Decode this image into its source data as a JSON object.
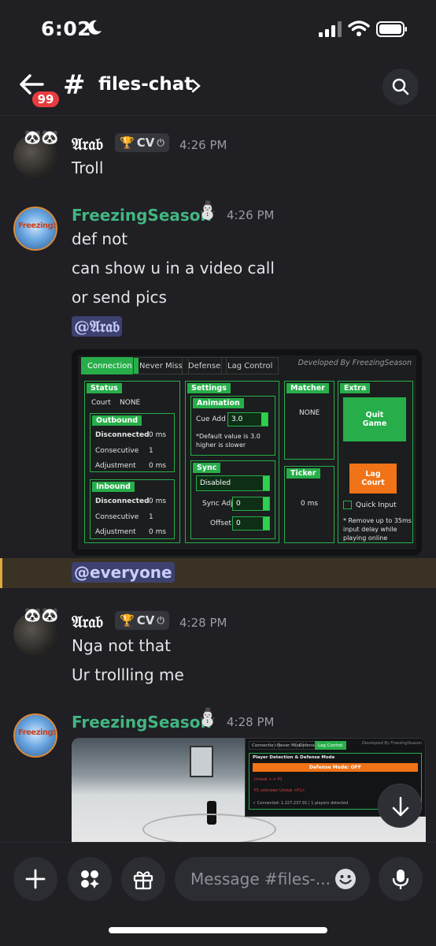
{
  "status_bar": {
    "time": "6:02"
  },
  "header": {
    "unread_badge": "99",
    "hash": "#",
    "channel_name": "files-chat"
  },
  "messages": [
    {
      "author": "𝔄𝔯𝔞𝔟",
      "tag": "CV",
      "time": "4:26 PM",
      "lines": [
        "Troll"
      ]
    },
    {
      "author": "FreezingSeason",
      "time": "4:26 PM",
      "avatar_text": "FreezingSeason",
      "lines": [
        "def not",
        "can show u in a video call",
        "or send pics"
      ],
      "mention": "@𝔄𝔯𝔞𝔟"
    },
    {
      "mention": "@everyone"
    },
    {
      "author": "𝔄𝔯𝔞𝔟",
      "tag": "CV",
      "time": "4:28 PM",
      "lines": [
        "Nga not that",
        "Ur trollling me"
      ]
    },
    {
      "author": "FreezingSeason",
      "time": "4:28 PM",
      "avatar_text": "FreezingSeason"
    }
  ],
  "screenshot1": {
    "tabs": [
      "Connection",
      "Never Miss",
      "Defense",
      "Lag Control"
    ],
    "developed_by": "Developed By FreezingSeason",
    "status": {
      "title": "Status",
      "court_label": "Court",
      "court_value": "NONE",
      "outbound": {
        "title": "Outbound",
        "disconnected": "Disconnected",
        "disconnected_val": "0 ms",
        "consecutive": "Consecutive",
        "consecutive_val": "1",
        "adjustment": "Adjustment",
        "adjustment_val": "0 ms"
      },
      "inbound": {
        "title": "Inbound",
        "disconnected": "Disconnected",
        "disconnected_val": "0 ms",
        "consecutive": "Consecutive",
        "consecutive_val": "1",
        "adjustment": "Adjustment",
        "adjustment_val": "0 ms"
      }
    },
    "settings": {
      "title": "Settings",
      "animation": "Animation",
      "cue_add": "Cue Add",
      "cue_val": "3.0",
      "note1": "*Default value is 3.0",
      "note2": "higher is slower",
      "sync": "Sync",
      "sync_state": "Disabled",
      "sync_adj": "Sync Adj",
      "sync_adj_val": "0",
      "offset": "Offset",
      "offset_val": "0"
    },
    "matcher": {
      "title": "Matcher",
      "value": "NONE"
    },
    "ticker": {
      "title": "Ticker",
      "value": "0 ms"
    },
    "extra": {
      "title": "Extra",
      "quit_line1": "Quit",
      "quit_line2": "Game",
      "lag_line1": "Lag",
      "lag_line2": "Court",
      "quick_input": "Quick Input",
      "note1": "* Remove up to 35ms",
      "note2": "input delay while",
      "note3": "playing online"
    }
  },
  "screenshot2": {
    "tabs": [
      "Connection",
      "Never Miss",
      "Defense",
      "Lag Control"
    ],
    "developed_by": "Developed By FreezingSeason",
    "section": "Player Detection & Defense Mode",
    "mode": "Defense Mode: OFF",
    "line1": "Unreal <-> P1",
    "line2": "P1 unknown Unreal <P1>",
    "footer": "✓ Connected: 1.227.237.91 | 1 players detected"
  },
  "composer": {
    "placeholder": "Message #files-..."
  },
  "colors": {
    "background": "#1f1f24",
    "accent_green": "#43b581",
    "mention_bg": "#3d4170",
    "app_green": "#27ae4a",
    "app_orange": "#f07317"
  }
}
